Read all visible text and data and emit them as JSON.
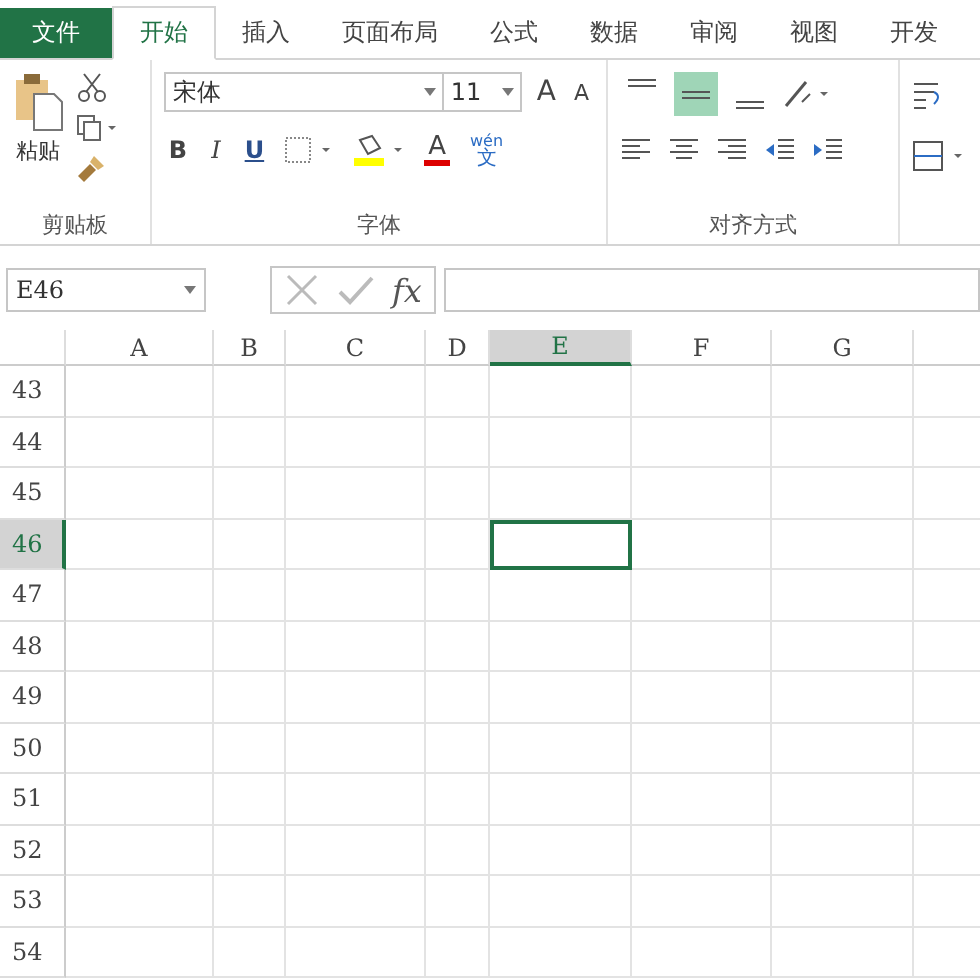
{
  "tabs": [
    {
      "label": "文件",
      "kind": "file",
      "selected": false
    },
    {
      "label": "开始",
      "kind": "tab",
      "selected": true
    },
    {
      "label": "插入",
      "kind": "tab",
      "selected": false
    },
    {
      "label": "页面布局",
      "kind": "tab",
      "selected": false
    },
    {
      "label": "公式",
      "kind": "tab",
      "selected": false
    },
    {
      "label": "数据",
      "kind": "tab",
      "selected": false
    },
    {
      "label": "审阅",
      "kind": "tab",
      "selected": false
    },
    {
      "label": "视图",
      "kind": "tab",
      "selected": false
    },
    {
      "label": "开发",
      "kind": "tab",
      "selected": false
    }
  ],
  "clipboard": {
    "paste_label": "粘贴",
    "group_label": "剪贴板"
  },
  "font": {
    "name": "宋体",
    "size": "11",
    "grow_label": "A",
    "shrink_label": "A",
    "bold": "B",
    "italic": "I",
    "underline": "U",
    "font_color_label": "A",
    "phonetic_top": "wén",
    "phonetic_bottom": "文",
    "group_label": "字体"
  },
  "alignment": {
    "vertical": [
      {
        "kind": "top",
        "selected": false
      },
      {
        "kind": "middle",
        "selected": true
      },
      {
        "kind": "bottom",
        "selected": false
      }
    ],
    "group_label": "对齐方式"
  },
  "formula_bar": {
    "name_box": "E46",
    "fx": "fx"
  },
  "sheet": {
    "columns": [
      {
        "label": "A",
        "selected": false
      },
      {
        "label": "B",
        "selected": false
      },
      {
        "label": "C",
        "selected": false
      },
      {
        "label": "D",
        "selected": false
      },
      {
        "label": "E",
        "selected": true
      },
      {
        "label": "F",
        "selected": false
      },
      {
        "label": "G",
        "selected": false
      }
    ],
    "rows": [
      {
        "label": "43",
        "selected": false
      },
      {
        "label": "44",
        "selected": false
      },
      {
        "label": "45",
        "selected": false
      },
      {
        "label": "46",
        "selected": true
      },
      {
        "label": "47",
        "selected": false
      },
      {
        "label": "48",
        "selected": false
      },
      {
        "label": "49",
        "selected": false
      },
      {
        "label": "50",
        "selected": false
      },
      {
        "label": "51",
        "selected": false
      },
      {
        "label": "52",
        "selected": false
      },
      {
        "label": "53",
        "selected": false
      },
      {
        "label": "54",
        "selected": false
      }
    ]
  }
}
